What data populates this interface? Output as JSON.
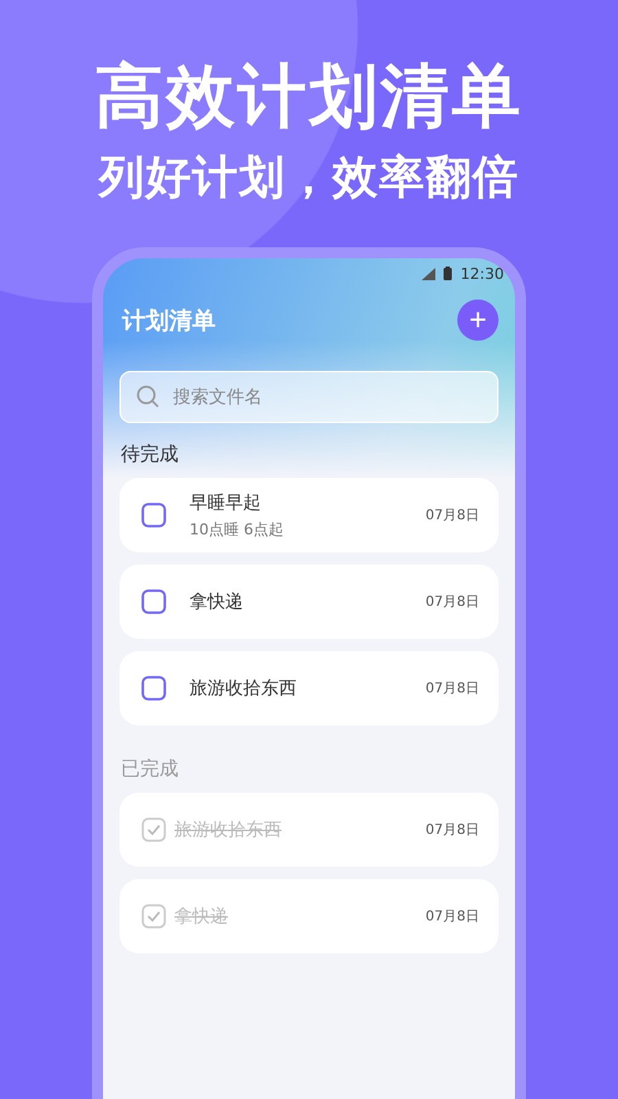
{
  "headline": "高效计划清单",
  "subheadline": "列好计划，效率翻倍",
  "status_bar": {
    "time": "12:30"
  },
  "app_bar": {
    "title": "计划清单",
    "add_button": "+"
  },
  "search": {
    "placeholder": "搜索文件名"
  },
  "sections": [
    {
      "title": "待完成",
      "items": [
        {
          "title": "早睡早起",
          "note": "10点睡 6点起",
          "date": "07月8日",
          "checked": false
        },
        {
          "title": "拿快递",
          "date": "07月8日",
          "checked": false
        },
        {
          "title": "旅游收拾东西",
          "date": "07月8日",
          "checked": false
        }
      ]
    },
    {
      "title": "已完成",
      "items": [
        {
          "title": "旅游收拾东西",
          "date": "07月8日",
          "checked": true
        },
        {
          "title": "拿快递",
          "date": "07月8日",
          "checked": true
        }
      ]
    }
  ]
}
